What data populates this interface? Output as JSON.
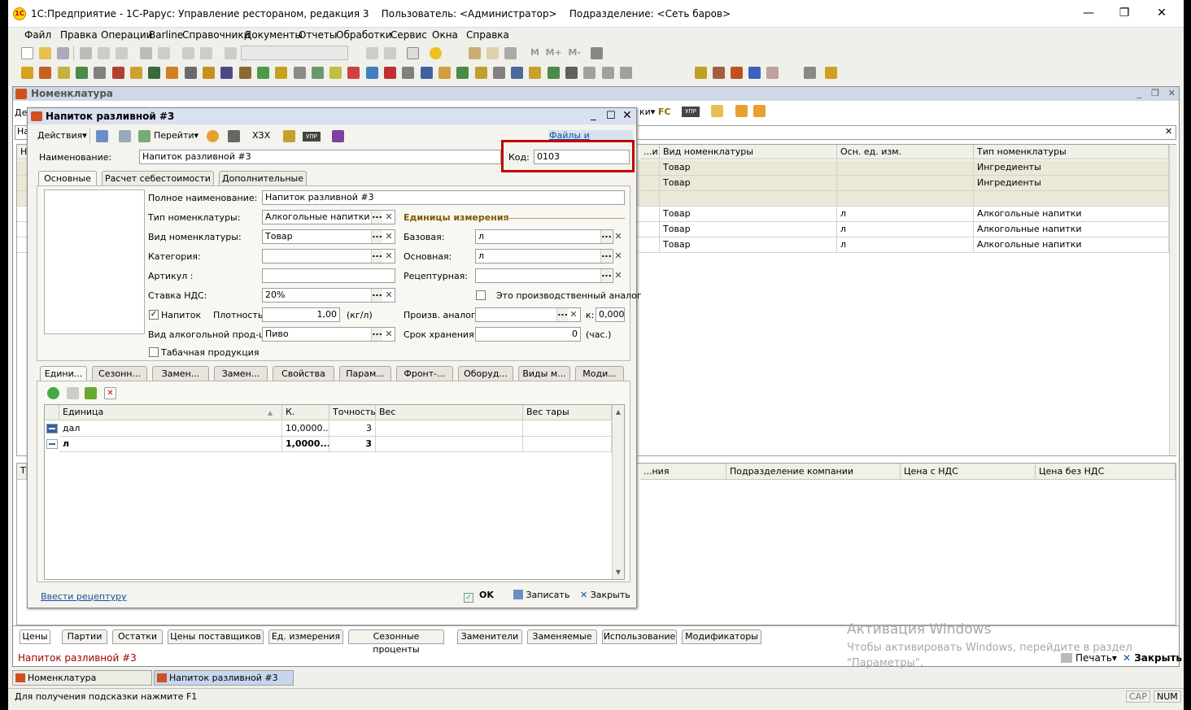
{
  "window": {
    "title": "1С:Предприятие - 1С-Рарус: Управление рестораном, редакция 3",
    "user": "Пользователь: <Администратор>",
    "division": "Подразделение: <Сеть баров>",
    "logo": "1С"
  },
  "menu": [
    "Файл",
    "Правка",
    "Операции",
    "Barline",
    "Справочники",
    "Документы",
    "Отчеты",
    "Обработки",
    "Сервис",
    "Окна",
    "Справка"
  ],
  "list_window": {
    "title": "Номенклатура",
    "columns": [
      "...и...",
      "Вид номенклатуры",
      "Осн. ед. изм.",
      "Тип номенклатуры"
    ],
    "rows": [
      [
        "",
        "Товар",
        "",
        "Ингредиенты"
      ],
      [
        "",
        "Товар",
        "",
        "Ингредиенты"
      ],
      [
        "",
        "",
        "",
        ""
      ],
      [
        "",
        "Товар",
        "л",
        "Алкогольные напитки"
      ],
      [
        "",
        "Товар",
        "л",
        "Алкогольные напитки"
      ],
      [
        "",
        "Товар",
        "л",
        "Алкогольные напитки"
      ]
    ],
    "price_columns": [
      "...ния",
      "Подразделение компании",
      "Цена с НДС",
      "Цена без НДС"
    ],
    "toolbar_tail": [
      "ки",
      "FC"
    ],
    "bottom_tabs": [
      "Цены",
      "Партии",
      "Остатки",
      "Цены поставщиков",
      "Ед. измерения",
      "Сезонные проценты",
      "Заменители",
      "Заменяемые",
      "Использование",
      "Модификаторы"
    ],
    "status_item": "Напиток разливной #3",
    "print_btn": "Печать",
    "close_btn": "Закрыть",
    "partial_left": [
      "Дей",
      "Наи",
      "На",
      "Т"
    ]
  },
  "dialog": {
    "title": "Напиток разливной #3",
    "toolbar": {
      "actions": "Действия",
      "goto": "Перейти",
      "hzh": "ХЗХ",
      "upr": "УПР",
      "files": "Файлы и картинки"
    },
    "name_label": "Наименование:",
    "name_value": "Напиток разливной #3",
    "code_label": "Код:",
    "code_value": "0103",
    "tabs": [
      "Основные",
      "Расчет себестоимости",
      "Дополнительные"
    ],
    "full_name_label": "Полное наименование:",
    "full_name_value": "Напиток разливной #3",
    "type_label": "Тип номенклатуры:",
    "type_value": "Алкогольные напитки",
    "kind_label": "Вид номенклатуры:",
    "kind_value": "Товар",
    "category_label": "Категория:",
    "category_value": "",
    "article_label": "Артикул :",
    "article_value": "",
    "vat_label": "Ставка НДС:",
    "vat_value": "20%",
    "drink_label": "Напиток",
    "density_label": "Плотность:",
    "density_value": "1,00",
    "density_unit": "(кг/л)",
    "alco_label": "Вид алкогольной прод-ции:",
    "alco_value": "Пиво",
    "tobacco_label": "Табачная продукция",
    "units_header": "Единицы измерения",
    "base_label": "Базовая:",
    "base_value": "л",
    "main_label": "Основная:",
    "main_value": "л",
    "recipe_label": "Рецептурная:",
    "recipe_value": "",
    "prod_analog_check": "Это производственный аналог",
    "prod_analog_label": "Произв. аналог:",
    "prod_analog_value": "",
    "k_label": "к:",
    "k_value": "0,000",
    "shelf_label": "Срок хранения:",
    "shelf_value": "0",
    "shelf_unit": "(час.)",
    "subtabs": [
      "Едини...",
      "Сезонн...",
      "Замен...",
      "Замен...",
      "Свойства",
      "Парам...",
      "Фронт-...",
      "Оборуд...",
      "Виды м...",
      "Моди..."
    ],
    "units_table": {
      "columns": [
        "Единица",
        "К.",
        "Точность",
        "Вес",
        "Вес тары"
      ],
      "rows": [
        [
          "дал",
          "10,0000...",
          "3",
          "",
          ""
        ],
        [
          "л",
          "1,0000...",
          "3",
          "",
          ""
        ]
      ]
    },
    "recipe_link": "Ввести рецептуру",
    "ok": "OK",
    "save": "Записать",
    "close": "Закрыть"
  },
  "taskbar": [
    "Номенклатура",
    "Напиток разливной #3"
  ],
  "status": {
    "hint": "Для получения подсказки нажмите F1",
    "cap": "CAP",
    "num": "NUM"
  },
  "activation": {
    "title": "Активация Windows",
    "line1": "Чтобы активировать Windows, перейдите в раздел",
    "line2": "\"Параметры\"."
  },
  "colors": {
    "highlight": "#c00000",
    "title_bg": "#d7e1f0",
    "accent_text": "#7a5c00"
  }
}
